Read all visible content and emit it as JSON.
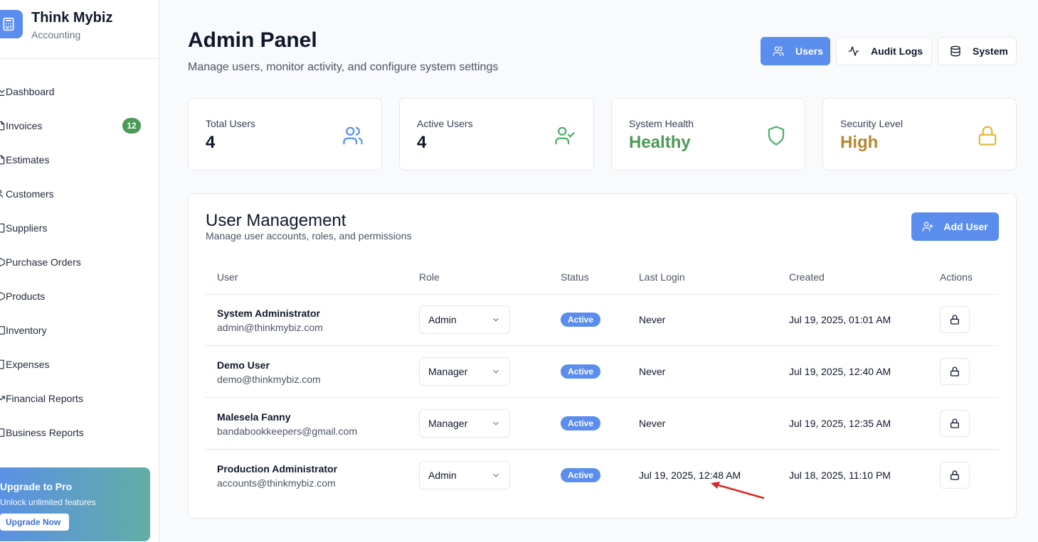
{
  "brand": {
    "title": "Think Mybiz",
    "subtitle": "Accounting",
    "logo_icon": "calculator-icon",
    "color": "#5b8def"
  },
  "sidebar": {
    "items": [
      {
        "label": "Dashboard",
        "icon": "chart-icon"
      },
      {
        "label": "Invoices",
        "icon": "file-icon",
        "badge": "12"
      },
      {
        "label": "Estimates",
        "icon": "file-icon"
      },
      {
        "label": "Customers",
        "icon": "users-icon"
      },
      {
        "label": "Suppliers",
        "icon": "building-icon"
      },
      {
        "label": "Purchase Orders",
        "icon": "package-icon"
      },
      {
        "label": "Products",
        "icon": "box-icon"
      },
      {
        "label": "Inventory",
        "icon": "warehouse-icon"
      },
      {
        "label": "Expenses",
        "icon": "receipt-icon"
      },
      {
        "label": "Financial Reports",
        "icon": "trending-icon"
      },
      {
        "label": "Business Reports",
        "icon": "report-icon"
      }
    ],
    "badge_color": "#4b9a5a"
  },
  "upgrade": {
    "title": "Upgrade to Pro",
    "subtitle": "Unlock unlimited features",
    "button": "Upgrade Now"
  },
  "header": {
    "title": "Admin Panel",
    "subtitle": "Manage users, monitor activity, and configure system settings"
  },
  "tabs": [
    {
      "label": "Users",
      "icon": "users-icon",
      "active": true
    },
    {
      "label": "Audit Logs",
      "icon": "activity-icon",
      "active": false
    },
    {
      "label": "System",
      "icon": "database-icon",
      "active": false
    }
  ],
  "stats": [
    {
      "label": "Total Users",
      "value": "4",
      "icon": "users-icon",
      "color": "#0f172a",
      "icon_color": "#5b8def"
    },
    {
      "label": "Active Users",
      "value": "4",
      "icon": "user-check-icon",
      "color": "#0f172a",
      "icon_color": "#4caf6a"
    },
    {
      "label": "System Health",
      "value": "Healthy",
      "icon": "shield-icon",
      "color": "#4c9a56",
      "icon_color": "#4caf6a"
    },
    {
      "label": "Security Level",
      "value": "High",
      "icon": "lock-icon",
      "color": "#b8862e",
      "icon_color": "#e3b93b"
    }
  ],
  "user_management": {
    "title": "User Management",
    "subtitle": "Manage user accounts, roles, and permissions",
    "add_button": "Add User",
    "columns": [
      "User",
      "Role",
      "Status",
      "Last Login",
      "Created",
      "Actions"
    ],
    "rows": [
      {
        "name": "System Administrator",
        "email": "admin@thinkmybiz.com",
        "role": "Admin",
        "status": "Active",
        "last_login": "Never",
        "created": "Jul 19, 2025, 01:01 AM"
      },
      {
        "name": "Demo User",
        "email": "demo@thinkmybiz.com",
        "role": "Manager",
        "status": "Active",
        "last_login": "Never",
        "created": "Jul 19, 2025, 12:40 AM"
      },
      {
        "name": "Malesela Fanny",
        "email": "bandabookkeepers@gmail.com",
        "role": "Manager",
        "status": "Active",
        "last_login": "Never",
        "created": "Jul 19, 2025, 12:35 AM"
      },
      {
        "name": "Production Administrator",
        "email": "accounts@thinkmybiz.com",
        "role": "Admin",
        "status": "Active",
        "last_login": "Jul 19, 2025, 12:48 AM",
        "created": "Jul 18, 2025, 11:10 PM"
      }
    ]
  },
  "annotation": {
    "color": "#e02424"
  }
}
